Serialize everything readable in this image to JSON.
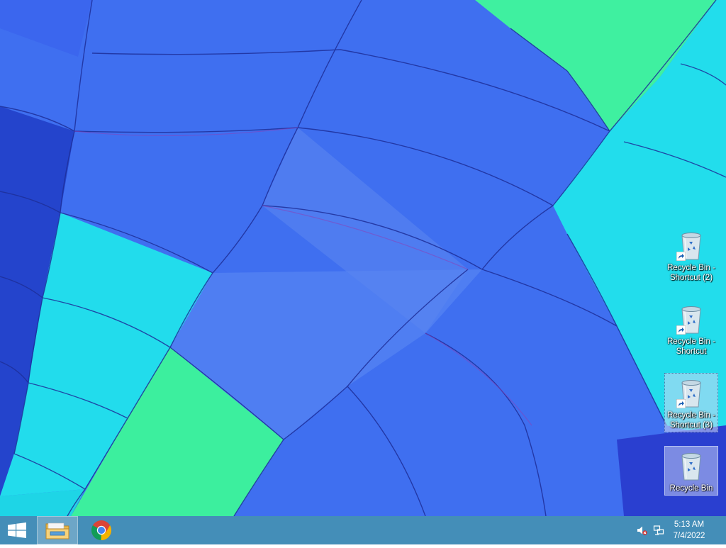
{
  "desktop": {
    "icons": [
      {
        "label": "Recycle Bin - Shortcut (2)",
        "icon": "recycle-bin-icon",
        "shortcut": true,
        "state": "normal"
      },
      {
        "label": "Recycle Bin - Shortcut",
        "icon": "recycle-bin-icon",
        "shortcut": true,
        "state": "normal"
      },
      {
        "label": "Recycle Bin - Shortcut (3)",
        "icon": "recycle-bin-icon",
        "shortcut": true,
        "state": "selected"
      },
      {
        "label": "Recycle Bin",
        "icon": "recycle-bin-icon",
        "shortcut": false,
        "state": "hover"
      }
    ]
  },
  "taskbar": {
    "start": {
      "icon": "windows-logo-icon"
    },
    "pinned": [
      {
        "icon": "file-explorer-icon",
        "active": true
      },
      {
        "icon": "chrome-icon",
        "active": false
      }
    ],
    "tray": [
      {
        "icon": "speaker-muted-icon"
      },
      {
        "icon": "network-icon"
      }
    ],
    "clock": {
      "time": "5:13 AM",
      "date": "7/4/2022"
    }
  },
  "colors": {
    "taskbar": "#4696aa",
    "wallpaper_blue": "#3f6ff0",
    "wallpaper_cyan": "#1fe2ec",
    "wallpaper_green": "#3cf0a0",
    "wallpaper_navy": "#2440c8"
  }
}
